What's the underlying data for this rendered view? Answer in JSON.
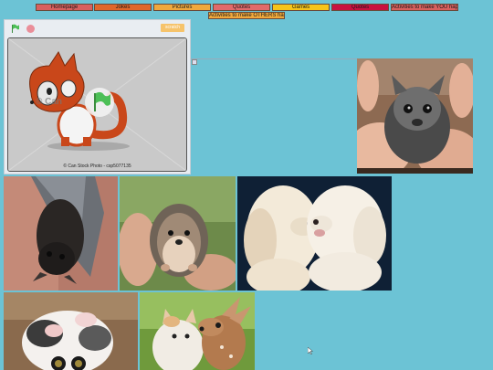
{
  "nav": {
    "items": [
      {
        "label": "Homepage",
        "color": "#d9605e"
      },
      {
        "label": "Jokes",
        "color": "#e0672b"
      },
      {
        "label": "Pictures",
        "color": "#f0a83c"
      },
      {
        "label": "Quotes",
        "color": "#e26a6a"
      },
      {
        "label": "Games",
        "color": "#f6c41a"
      },
      {
        "label": "Quotes",
        "color": "#c8113f"
      },
      {
        "label": "Activities to make YOU hap",
        "color": "#d9605e"
      },
      {
        "label": "Activities to make OTHERS hap",
        "color": "#f0a83c"
      }
    ]
  },
  "scratch": {
    "badge": "scratch",
    "caption": "© Can Stock Photo - csp5077135",
    "watermark": "© Can",
    "flag_icon": "green-flag-icon",
    "stop_icon": "stop-icon"
  },
  "colors": {
    "background": "#6cc3d5",
    "flag_green": "#4cbf56"
  }
}
